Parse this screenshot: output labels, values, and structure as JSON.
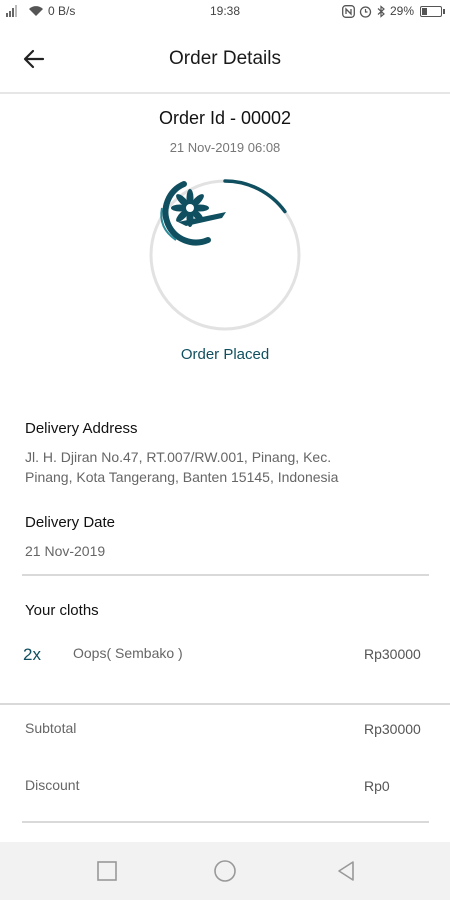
{
  "status_bar": {
    "network_speed": "0 B/s",
    "time": "19:38",
    "battery": "29%",
    "battery_level": 0.29,
    "icons": [
      "signal-icon",
      "wifi-icon",
      "nfc-icon",
      "alarm-icon",
      "bluetooth-icon",
      "battery-icon"
    ]
  },
  "app_bar": {
    "title": "Order Details",
    "back_icon": "arrow-left-icon"
  },
  "order": {
    "id_label": "Order Id - 00002",
    "datetime": "21 Nov-2019 06:08",
    "status": "Order Placed",
    "progress": 0.15,
    "accent_color": "#0f4f5f",
    "logo_icon": "company-logo"
  },
  "delivery": {
    "address_title": "Delivery Address",
    "address_line1": "Jl. H. Djiran No.47, RT.007/RW.001, Pinang, Kec.",
    "address_line2": "Pinang, Kota Tangerang, Banten 15145, Indonesia",
    "date_title": "Delivery Date",
    "date_value": "21 Nov-2019"
  },
  "cloths": {
    "title": "Your cloths",
    "items": [
      {
        "qty": "2x",
        "name": "Oops( Sembako )",
        "price": "Rp30000"
      }
    ]
  },
  "summary": {
    "subtotal_label": "Subtotal",
    "subtotal_value": "Rp30000",
    "discount_label": "Discount",
    "discount_value": "Rp0"
  },
  "nav_bar": {
    "icons": [
      "recent-apps-icon",
      "home-icon",
      "back-icon"
    ]
  }
}
